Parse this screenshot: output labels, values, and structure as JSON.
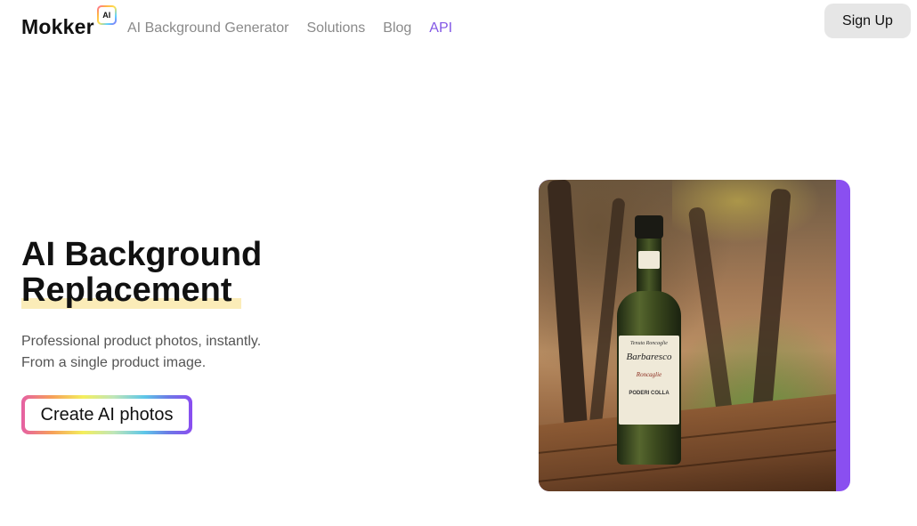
{
  "header": {
    "logo_text": "Mokker",
    "logo_badge": "AI",
    "nav": [
      {
        "label": "AI Background Generator",
        "active": false
      },
      {
        "label": "Solutions",
        "active": false
      },
      {
        "label": "Blog",
        "active": false
      },
      {
        "label": "API",
        "active": true
      }
    ],
    "signup_label": "Sign Up"
  },
  "hero": {
    "title_line1": "AI Background",
    "title_line2": "Replacement",
    "subtitle_line1": "Professional product photos, instantly.",
    "subtitle_line2": "From a single product image.",
    "cta_label": "Create AI photos"
  },
  "image": {
    "label_line1": "Tenuta Roncaglie",
    "label_line2": "Barbaresco",
    "label_line3": "Roncaglie",
    "label_line4": "PODERI COLLA"
  },
  "colors": {
    "accent": "#8257e5",
    "frame": "#8a4ff0",
    "highlight": "#fbecb8",
    "signup_bg": "#e6e6e6"
  }
}
